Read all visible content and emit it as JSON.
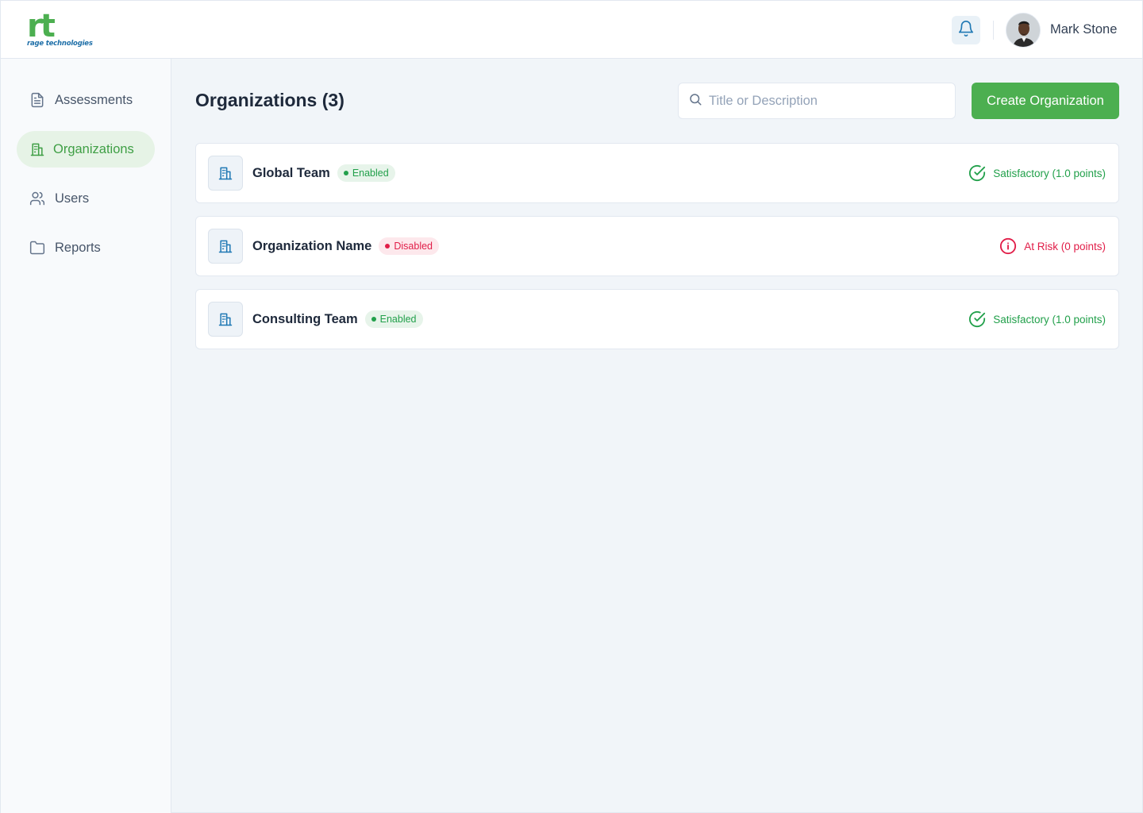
{
  "brand": {
    "logo_mark": "rt",
    "logo_text": "rage technologies"
  },
  "header": {
    "user_name": "Mark Stone",
    "notifications_icon": "bell-icon"
  },
  "sidebar": {
    "items": [
      {
        "label": "Assessments",
        "icon": "document-icon",
        "active": false
      },
      {
        "label": "Organizations",
        "icon": "building-icon",
        "active": true
      },
      {
        "label": "Users",
        "icon": "users-icon",
        "active": false
      },
      {
        "label": "Reports",
        "icon": "folder-icon",
        "active": false
      }
    ]
  },
  "main": {
    "title": "Organizations (3)",
    "search": {
      "placeholder": "Title or Description",
      "value": ""
    },
    "create_button": "Create Organization",
    "organizations": [
      {
        "name": "Global Team",
        "badge": "Enabled",
        "status": "Satisfactory (1.0 points)"
      },
      {
        "name": "Organization Name",
        "badge": "Disabled",
        "status": "At Risk (0 points)"
      },
      {
        "name": "Consulting Team",
        "badge": "Enabled",
        "status": "Satisfactory (1.0 points)"
      }
    ]
  },
  "colors": {
    "brand_green": "#4caf50",
    "brand_blue": "#1e6fa8",
    "success": "#22a04b",
    "danger": "#e11d48",
    "icon_blue": "#1f78b4"
  }
}
